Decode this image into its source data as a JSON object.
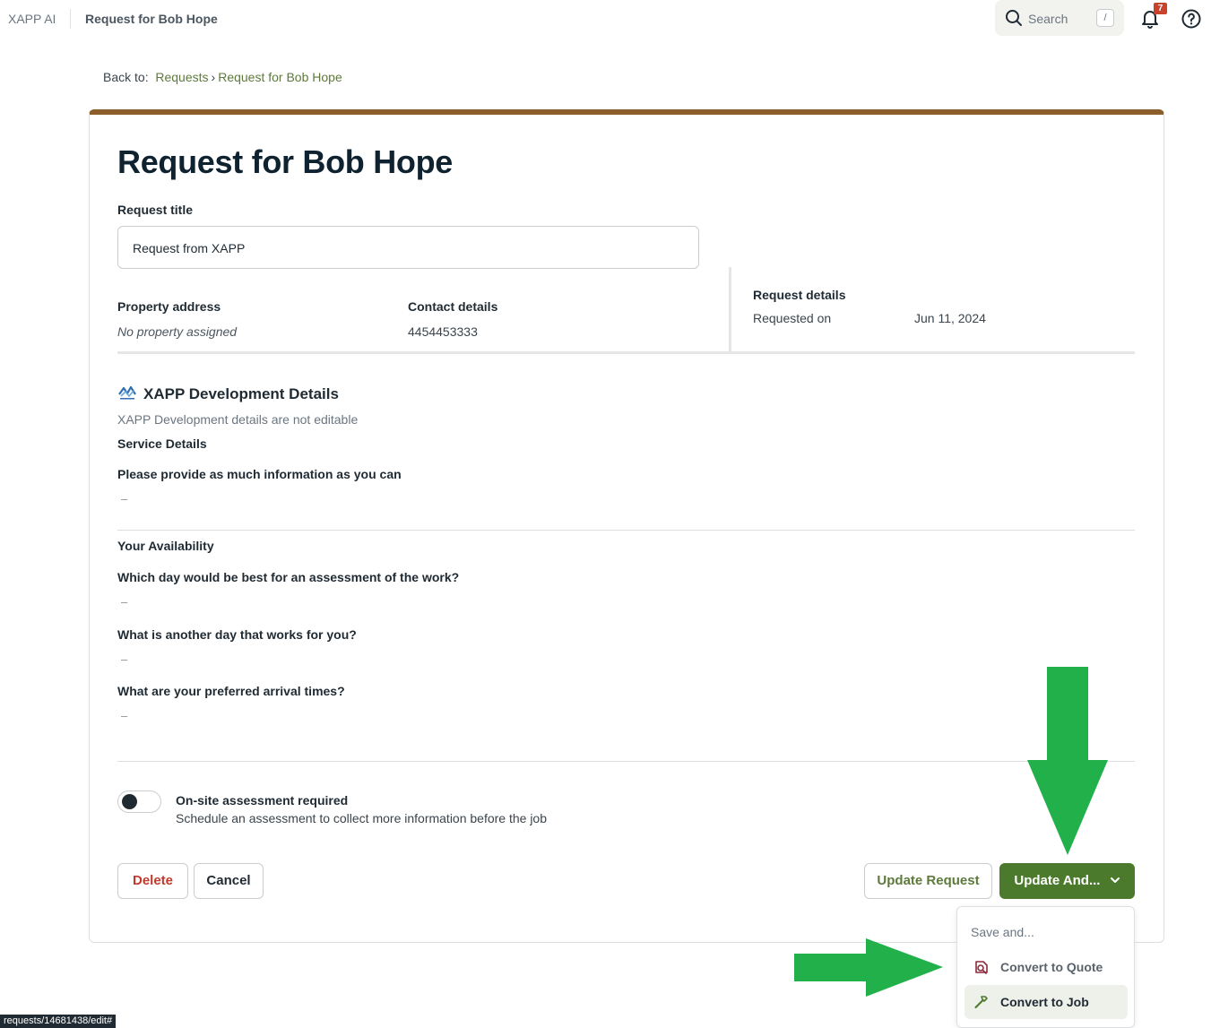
{
  "topbar": {
    "app_name": "XAPP AI",
    "page_name": "Request for Bob Hope",
    "search_label": "Search",
    "search_shortcut": "/",
    "notification_count": "7"
  },
  "breadcrumb": {
    "prefix": "Back to:",
    "items": [
      "Requests",
      "Request for Bob Hope"
    ]
  },
  "request": {
    "heading": "Request for Bob Hope",
    "title_label": "Request title",
    "title_value": "Request from XAPP",
    "property_label": "Property address",
    "property_value": "No property assigned",
    "contact_label": "Contact details",
    "contact_value": "4454453333",
    "details_label": "Request details",
    "requested_on_label": "Requested on",
    "requested_on_value": "Jun 11, 2024"
  },
  "integration": {
    "title": "XAPP Development Details",
    "note": "XAPP Development details are not editable",
    "service_heading": "Service Details",
    "info_question": "Please provide as much information as you can",
    "info_answer": "–",
    "availability_heading": "Your Availability",
    "q1": "Which day would be best for an assessment of the work?",
    "a1": "–",
    "q2": "What is another day that works for you?",
    "a2": "–",
    "q3": "What are your preferred arrival times?",
    "a3": "–"
  },
  "assessment": {
    "label": "On-site assessment required",
    "description": "Schedule an assessment to collect more information before the job",
    "enabled": false
  },
  "actions": {
    "delete": "Delete",
    "cancel": "Cancel",
    "update": "Update Request",
    "update_and": "Update And..."
  },
  "menu": {
    "heading": "Save and...",
    "items": [
      "Convert to Quote",
      "Convert to Job"
    ]
  },
  "status_url": "requests/14681438/edit#",
  "colors": {
    "accent_green": "#4c7a2c",
    "card_top_border": "#8b5e2b",
    "delete_red": "#c0392b",
    "annotation_arrow": "#22b04b"
  }
}
